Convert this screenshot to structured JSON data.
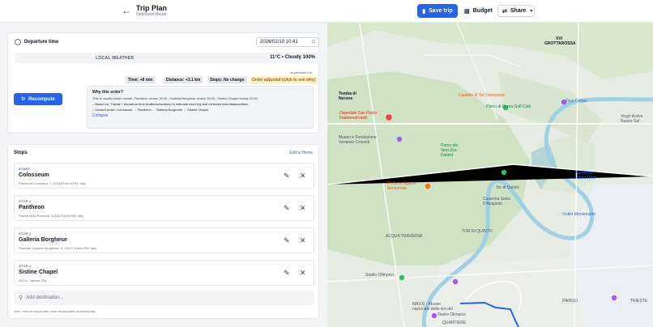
{
  "header": {
    "back_icon": "arrow-left-icon",
    "title": "Trip Plan",
    "subtitle": "Optimized Route",
    "save_label": "Save trip",
    "budget_label": "Budget",
    "share_label": "Share"
  },
  "departure": {
    "label": "Departure time",
    "value": "2026/02/10 10:41",
    "weather_label": "LOCAL WEATHER",
    "weather_value": "11°C • Cloudy 100%",
    "vs_text": "vs previous run",
    "chips": [
      "Time: +8 min",
      "Distance: +3.1 km",
      "Stops: No change",
      "Order adjusted (click to see why)"
    ],
    "recompute_label": "Recompute",
    "why": {
      "title": "Why this order?",
      "line1": "This is usually faster overall. Pantheon closes 19:00 ; Galleria Borghese closes 19:00 ; Sistine Chapel closes 20:00",
      "line2": "– Based on: Transit + departure time (traffic/schedules) to estimate each leg and minimize total distance/time.",
      "line3": "– Current order: Colosseum → Pantheon → Galleria Borghese → Sistine Chapel",
      "collapse": "Collapse"
    }
  },
  "stops": {
    "title": "Stops",
    "edit_label": "Edit in Home",
    "items": [
      {
        "tag": "START",
        "name": "Colosseum",
        "address": "Piazza del Colosseo, 1, 00184 Roma RM, Italy"
      },
      {
        "tag": "STOP 1",
        "name": "Pantheon",
        "address": "Piazza della Rotonda, 00186 Roma RM, Italy"
      },
      {
        "tag": "STOP 2",
        "name": "Galleria Borghese",
        "address": "Piazzale Scipione Borghese, 5, 00197 Roma RM, Italy"
      },
      {
        "tag": "STOP 3",
        "name": "Sistine Chapel",
        "address": "00120, Vatican City"
      }
    ],
    "add_placeholder": "Add destination...",
    "hint": "Add / remove stops then route recalculates automatically."
  },
  "map": {
    "labels": {
      "grottarossa": "GROTTAROSSA",
      "xvi": "XVI",
      "tomba": "Tomba di\nNerone",
      "castello": "Castello di Tor Crescenza",
      "parco": "Parco di Roma Golf Club",
      "toyz": "Toyz Center",
      "virgin": "Virgin Active\nNuovo Sal",
      "ospedale": "Ospedale San Pietro\nFatebenefratelli",
      "museo": "Museo e Fondazione\nVenanzo Crocetti",
      "pdv": "Parco dei\nVeio Zoo\nDistrict",
      "borghese": "Villa Borghese",
      "profumo": "Profumo Spazio\nSensoriale",
      "tordi": "Tor di Quinto",
      "caserma": "Caserma Salvo\nD'Acquisto",
      "aeroporto": "Aeroporto\nRoma Urbe",
      "outlet": "Outlet Montemario",
      "acqua": "ACQUA TRAVERSA",
      "quinto": "TOR DI QUINTO",
      "stadio": "Stadio Olimpico",
      "maxxi": "MAXXI - Museo\nnazionale delle arti del",
      "teatro": "Teatro Olimpico",
      "quartiere": "QUARTIERE",
      "parioli": "PARIOLI",
      "trieste": "TRIESTE"
    }
  }
}
